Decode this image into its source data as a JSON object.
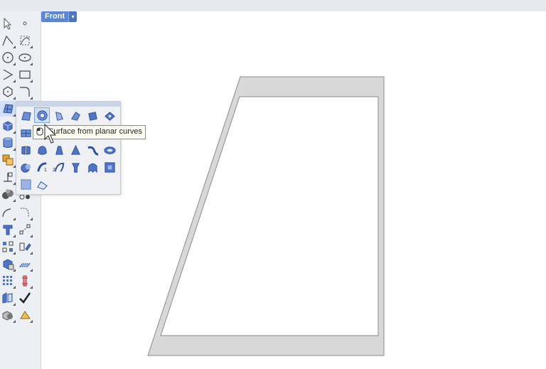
{
  "viewport": {
    "title": "Front",
    "dropdown_glyph": "▾"
  },
  "tooltip": {
    "text": "Surface from planar curves"
  },
  "flyout": {
    "title": "Surface flyout",
    "active_tool": "surface-from-planar-curves",
    "badges": {
      "one": "1",
      "two": "2"
    }
  },
  "left_toolbar": {
    "icons": [
      "select-arrow-icon",
      "point-icon",
      "polyline-icon",
      "curve-control-points-icon",
      "circle-icon",
      "ellipse-icon",
      "arc-icon",
      "rectangle-icon",
      "polygon-icon",
      "fillet-curve-icon",
      "surface-icon",
      "box-icon",
      "cylinder-icon",
      "boolean-icon",
      "extrude-icon",
      "render-icon",
      "offset-icon",
      "blend-icon",
      "text-icon",
      "dimension-icon",
      "array-icon",
      "mirror-icon",
      "mesh-icon",
      "edit-icon",
      "grid-icon",
      "gumball-icon",
      "analyze-icon",
      "check-icon",
      "shade-icon",
      "material-icon"
    ]
  },
  "colors": {
    "accent": "#5b86d6",
    "icon_blue": "#3d63b8",
    "shape_fill": "#d8d8d8",
    "shape_stroke": "#8a8a8a"
  }
}
